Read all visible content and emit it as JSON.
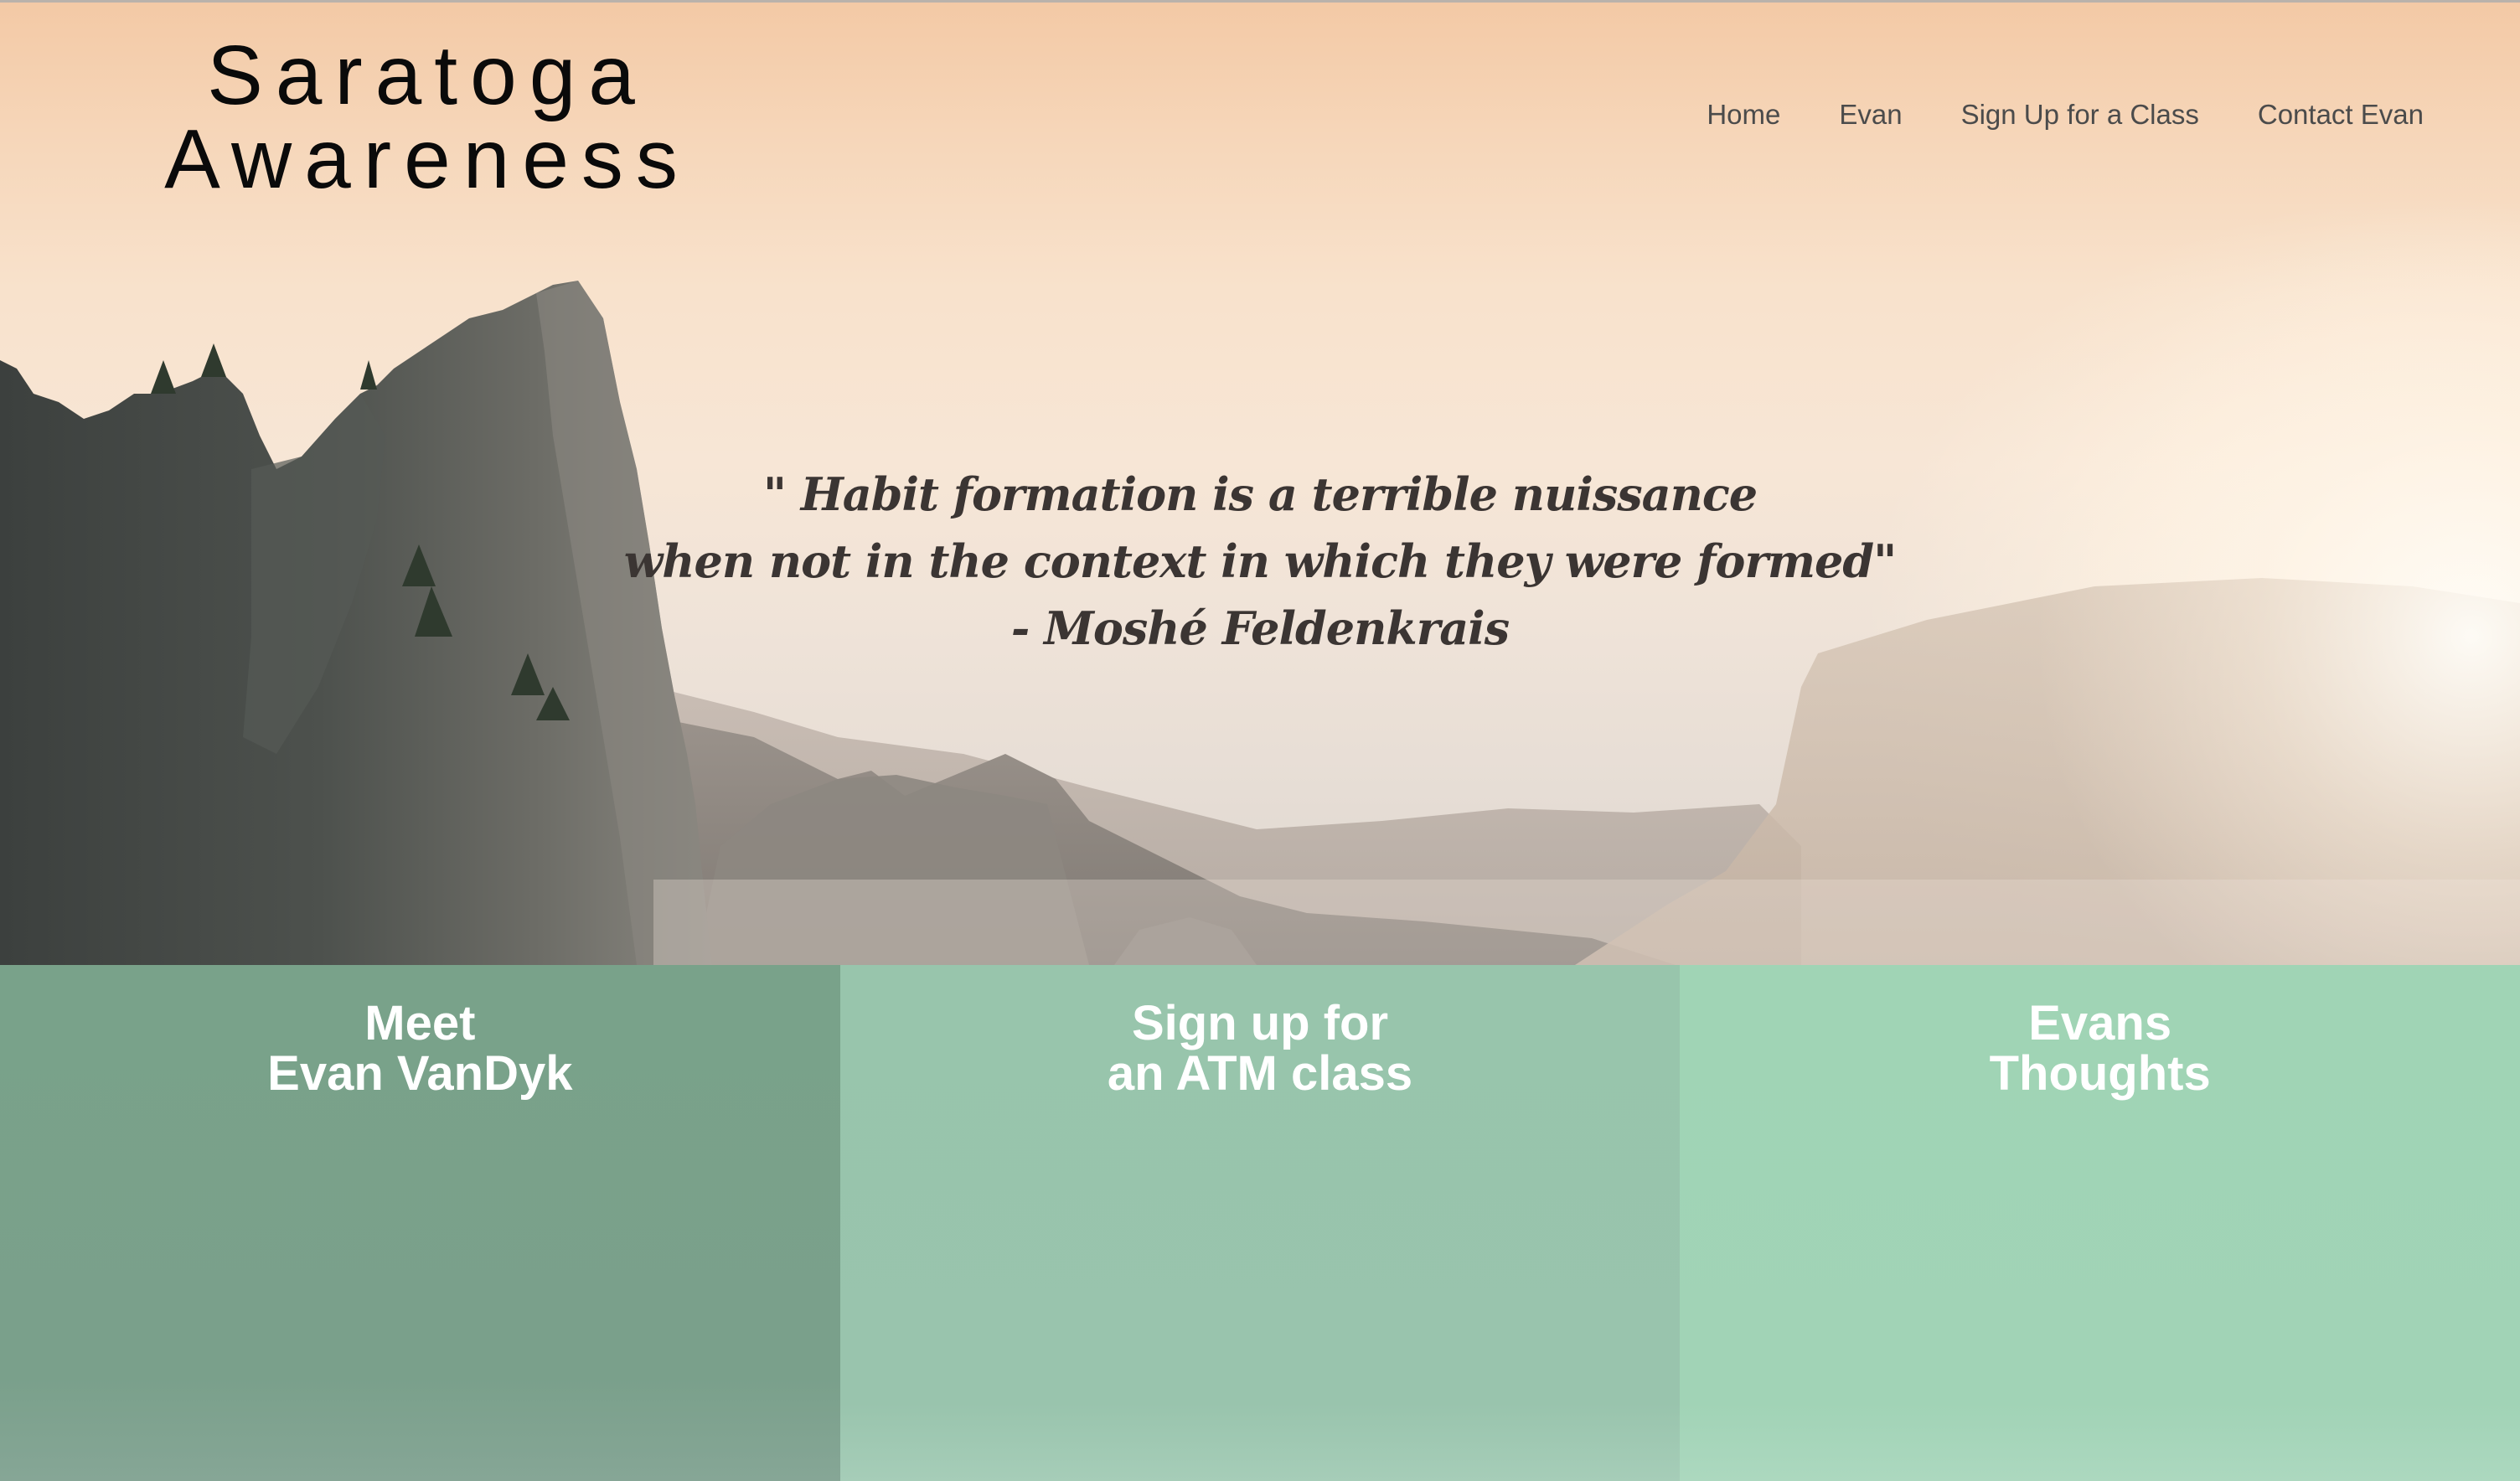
{
  "site": {
    "logo_line1": "Saratoga",
    "logo_line2": "Awareness"
  },
  "nav": {
    "items": [
      {
        "label": "Home"
      },
      {
        "label": "Evan"
      },
      {
        "label": "Sign Up for a Class"
      },
      {
        "label": "Contact Evan"
      }
    ]
  },
  "hero": {
    "quote_line1": "\" Habit formation is a terrible nuissance",
    "quote_line2": "when not in the context in which they were formed\"",
    "quote_author": "- Moshé Feldenkrais"
  },
  "panels": [
    {
      "line1": "Meet",
      "line2": "Evan VanDyk"
    },
    {
      "line1": "Sign up for",
      "line2": "an ATM class"
    },
    {
      "line1": "Evans",
      "line2": "Thoughts"
    }
  ],
  "colors": {
    "panel_1": "#79a28a",
    "panel_2": "#98c5ac",
    "panel_3": "#a0d4b5",
    "nav_text": "#4b4b4b",
    "quote_text": "#3b3533"
  }
}
